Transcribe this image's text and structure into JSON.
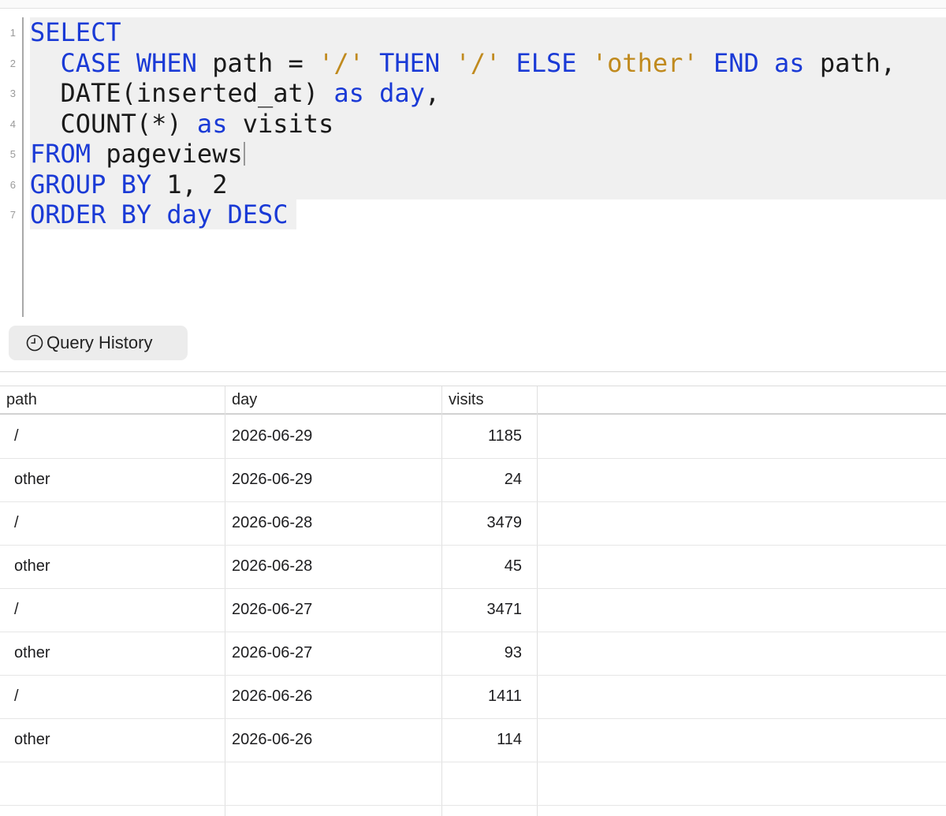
{
  "editor": {
    "line_numbers": [
      "1",
      "2",
      "3",
      "4",
      "5",
      "6",
      "7"
    ],
    "lines": [
      [
        {
          "t": "SELECT",
          "c": "kw"
        }
      ],
      [
        {
          "t": "  "
        },
        {
          "t": "CASE",
          "c": "kw"
        },
        {
          "t": " "
        },
        {
          "t": "WHEN",
          "c": "kw"
        },
        {
          "t": " path = "
        },
        {
          "t": "'/'",
          "c": "str"
        },
        {
          "t": " "
        },
        {
          "t": "THEN",
          "c": "kw"
        },
        {
          "t": " "
        },
        {
          "t": "'/'",
          "c": "str"
        },
        {
          "t": " "
        },
        {
          "t": "ELSE",
          "c": "kw"
        },
        {
          "t": " "
        },
        {
          "t": "'other'",
          "c": "str"
        },
        {
          "t": " "
        },
        {
          "t": "END",
          "c": "kw"
        },
        {
          "t": " "
        },
        {
          "t": "as",
          "c": "kw"
        },
        {
          "t": " path,"
        }
      ],
      [
        {
          "t": "  DATE(inserted_at) "
        },
        {
          "t": "as",
          "c": "kw"
        },
        {
          "t": " "
        },
        {
          "t": "day",
          "c": "kw"
        },
        {
          "t": ","
        }
      ],
      [
        {
          "t": "  COUNT(*) "
        },
        {
          "t": "as",
          "c": "kw"
        },
        {
          "t": " visits"
        }
      ],
      [
        {
          "t": "FROM",
          "c": "kw"
        },
        {
          "t": " pageviews"
        }
      ],
      [
        {
          "t": "GROUP",
          "c": "kw"
        },
        {
          "t": " "
        },
        {
          "t": "BY",
          "c": "kw"
        },
        {
          "t": " 1, 2"
        }
      ],
      [
        {
          "t": "ORDER",
          "c": "kw"
        },
        {
          "t": " "
        },
        {
          "t": "BY",
          "c": "kw"
        },
        {
          "t": " "
        },
        {
          "t": "day",
          "c": "kw"
        },
        {
          "t": " "
        },
        {
          "t": "DESC",
          "c": "kw"
        }
      ]
    ],
    "colors": {
      "keyword": "#1a3ad6",
      "string": "#c08a1e",
      "selection": "#f0f0f0"
    }
  },
  "query_history": {
    "label": "Query History",
    "icon": "clock-icon"
  },
  "results": {
    "columns": [
      "path",
      "day",
      "visits"
    ],
    "rows": [
      [
        "/",
        "2026-06-29",
        "1185"
      ],
      [
        "other",
        "2026-06-29",
        "24"
      ],
      [
        "/",
        "2026-06-28",
        "3479"
      ],
      [
        "other",
        "2026-06-28",
        "45"
      ],
      [
        "/",
        "2026-06-27",
        "3471"
      ],
      [
        "other",
        "2026-06-27",
        "93"
      ],
      [
        "/",
        "2026-06-26",
        "1411"
      ],
      [
        "other",
        "2026-06-26",
        "114"
      ]
    ]
  }
}
